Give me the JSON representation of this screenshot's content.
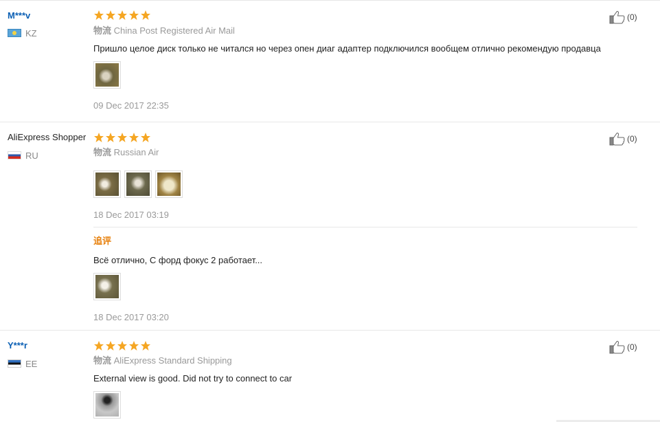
{
  "colors": {
    "star": "#f5a623",
    "user_link": "#0a5fb4",
    "additional_label": "#e7800c",
    "muted_text": "#999999"
  },
  "reviews": [
    {
      "user": "M***v",
      "user_style": "link",
      "flag": "kz-flag-icon",
      "country": "KZ",
      "stars": 5,
      "logistics_label": "物流",
      "logistics": "China Post Registered Air Mail",
      "text": "Пришло целое диск только не читался но через опен диаг адаптер подключился вообщем отлично рекомендую продавца",
      "photos": 1,
      "date": "09 Dec 2017 22:35",
      "helpful_count": "(0)"
    },
    {
      "user": "AliExpress Shopper",
      "user_style": "plain",
      "flag": "ru-flag-icon",
      "country": "RU",
      "stars": 5,
      "logistics_label": "物流",
      "logistics": "Russian Air",
      "text": "",
      "photos": 3,
      "date": "18 Dec 2017 03:19",
      "additional": {
        "label": "追评",
        "text": "Всё отлично, С форд фокус 2 работает...",
        "photos": 1,
        "date": "18 Dec 2017 03:20"
      },
      "helpful_count": "(0)"
    },
    {
      "user": "Y***r",
      "user_style": "link",
      "flag": "ee-flag-icon",
      "country": "EE",
      "stars": 5,
      "logistics_label": "物流",
      "logistics": "AliExpress Standard Shipping",
      "text": "External view is good. Did not try to connect to car",
      "photos": 1,
      "date": "",
      "helpful_count": "(0)"
    }
  ]
}
